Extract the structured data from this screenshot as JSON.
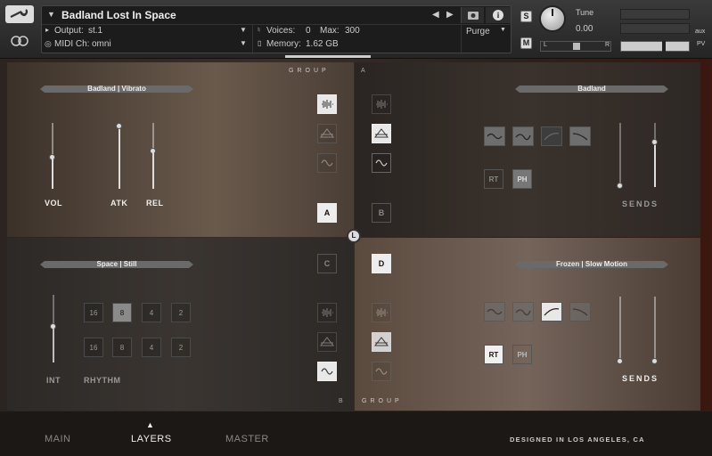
{
  "header": {
    "instrument_name": "Badland Lost In Space",
    "output_label": "Output:",
    "output_value": "st.1",
    "voices_label": "Voices:",
    "voices_value": "0",
    "max_label": "Max:",
    "max_value": "300",
    "midi_label": "MIDI Ch:",
    "midi_value": "omni",
    "memory_label": "Memory:",
    "memory_value": "1.62 GB",
    "purge_label": "Purge",
    "solo_label": "S",
    "mute_label": "M",
    "tune_label": "Tune",
    "tune_value": "0.00",
    "aux_label": "aux",
    "pv_label": "PV",
    "pan_left": "L",
    "pan_right": "R"
  },
  "group_label": "GROUP",
  "center_label": "L",
  "panel_a": {
    "preset": "Badland | Vibrato",
    "corner": "A",
    "vol_label": "VOL",
    "atk_label": "ATK",
    "rel_label": "REL",
    "letter": "A",
    "vol": 0.6,
    "atk": 1.0,
    "rel": 0.6
  },
  "panel_b": {
    "preset": "Badland",
    "letter": "B",
    "rt_label": "RT",
    "ph_label": "PH",
    "sends_label": "SENDS",
    "send1": 0.0,
    "send2": 0.7
  },
  "panel_c": {
    "preset": "Space | Still",
    "corner": "B",
    "letter": "C",
    "int_label": "INT",
    "rhythm_label": "RHYTHM",
    "row1": [
      "16",
      "8",
      "4",
      "2"
    ],
    "row2": [
      "16",
      "8",
      "4",
      "2"
    ],
    "int": 0.6
  },
  "panel_d": {
    "preset": "Frozen | Slow Motion",
    "letter": "D",
    "rt_label": "RT",
    "ph_label": "PH",
    "sends_label": "SENDS",
    "send1": 0.0,
    "send2": 0.0
  },
  "footer": {
    "tabs": [
      "MAIN",
      "LAYERS",
      "MASTER"
    ],
    "active_tab": "LAYERS",
    "credit": "DESIGNED IN LOS ANGELES, CA"
  }
}
